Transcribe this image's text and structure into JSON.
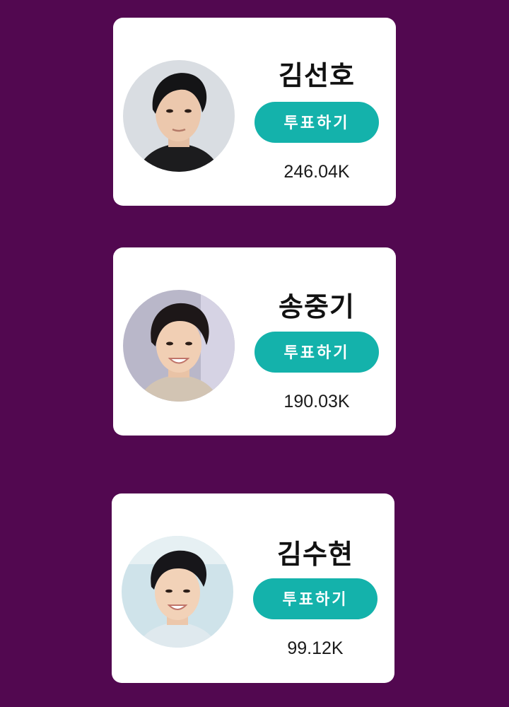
{
  "candidates": [
    {
      "name": "김선호",
      "vote_label": "투표하기",
      "votes": "246.04K"
    },
    {
      "name": "송중기",
      "vote_label": "투표하기",
      "votes": "190.03K"
    },
    {
      "name": "김수현",
      "vote_label": "투표하기",
      "votes": "99.12K"
    }
  ],
  "colors": {
    "background": "#520850",
    "card": "#ffffff",
    "vote_button": "#14b2ab",
    "vote_button_text": "#ffffff"
  }
}
